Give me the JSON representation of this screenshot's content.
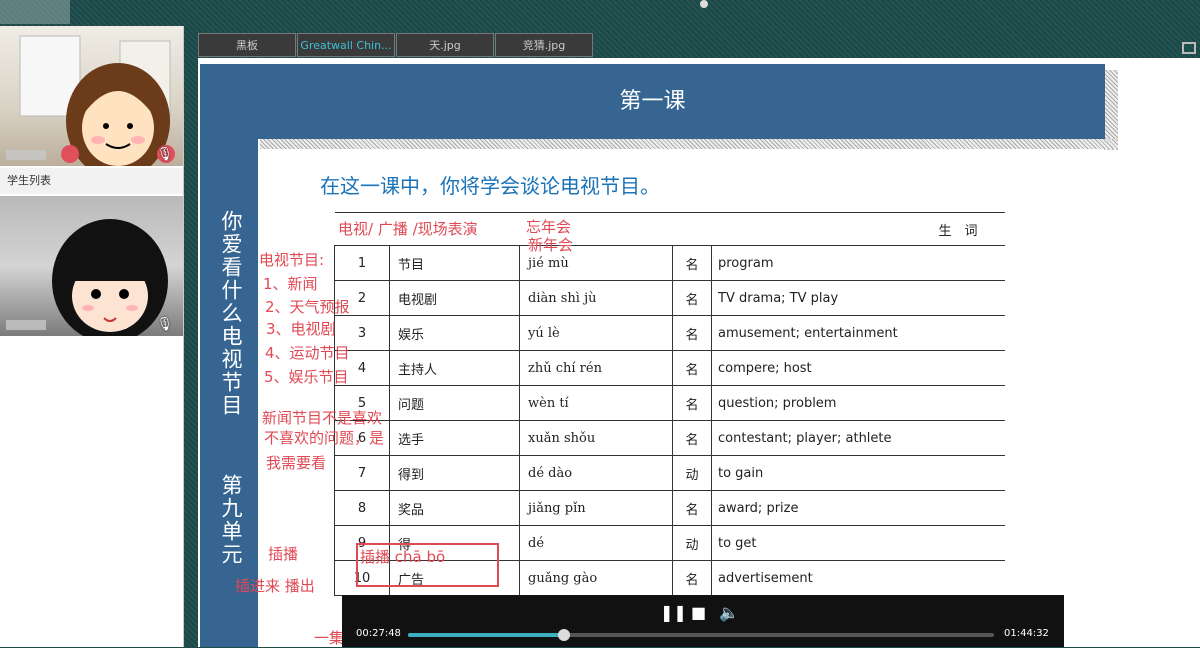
{
  "tabs": [
    {
      "label": "黑板",
      "active": false
    },
    {
      "label": "Greatwall Chin...",
      "active": true
    },
    {
      "label": "天.jpg",
      "active": false
    },
    {
      "label": "竞猜.jpg",
      "active": false
    }
  ],
  "left_panel": {
    "student_list_label": "学生列表"
  },
  "slide": {
    "lesson_title": "第一课",
    "unit_title": "第九单元",
    "unit_subtitle": "你爱看什么电视节目",
    "intro": "在这一课中，你将学会谈论电视节目。",
    "vocab_header": "生　词",
    "vocab": [
      {
        "no": "1",
        "hanzi": "节目",
        "pinyin": "jié mù",
        "pos": "名",
        "english": "program"
      },
      {
        "no": "2",
        "hanzi": "电视剧",
        "pinyin": "diàn shì jù",
        "pos": "名",
        "english": "TV drama; TV play"
      },
      {
        "no": "3",
        "hanzi": "娱乐",
        "pinyin": "yú lè",
        "pos": "名",
        "english": "amusement; entertainment"
      },
      {
        "no": "4",
        "hanzi": "主持人",
        "pinyin": "zhǔ chí rén",
        "pos": "名",
        "english": "compere; host"
      },
      {
        "no": "5",
        "hanzi": "问题",
        "pinyin": "wèn tí",
        "pos": "名",
        "english": "question; problem"
      },
      {
        "no": "6",
        "hanzi": "选手",
        "pinyin": "xuǎn shǒu",
        "pos": "名",
        "english": "contestant; player; athlete"
      },
      {
        "no": "7",
        "hanzi": "得到",
        "pinyin": "dé dào",
        "pos": "动",
        "english": "to gain"
      },
      {
        "no": "8",
        "hanzi": "奖品",
        "pinyin": "jiǎng pǐn",
        "pos": "名",
        "english": "award; prize"
      },
      {
        "no": "9",
        "hanzi": "得",
        "pinyin": "dé",
        "pos": "动",
        "english": "to get"
      },
      {
        "no": "10",
        "hanzi": "广告",
        "pinyin": "guǎng gào",
        "pos": "名",
        "english": "advertisement"
      }
    ]
  },
  "annotations": {
    "a1": "电视/ 广播 /现场表演",
    "a2": "忘年会",
    "a3": "新年会",
    "a4": "电视节目:",
    "a5": "1、新闻",
    "a6": "2、天气预报",
    "a7": "3、电视剧",
    "a8": "4、运动节目",
    "a9": "5、娱乐节目",
    "a10": "新闻节目不是喜欢",
    "a11": "不喜欢的问题，是",
    "a12": "我需要看",
    "a13": "插播",
    "a14": "插播  chā bō",
    "a15": "插进来  播出",
    "a16": "一集"
  },
  "player": {
    "current_time": "00:27:48",
    "total_time": "01:44:32",
    "progress": 0.266,
    "pause_icon": "pause-icon",
    "stop_icon": "stop-icon",
    "volume_icon": "volume-icon"
  }
}
